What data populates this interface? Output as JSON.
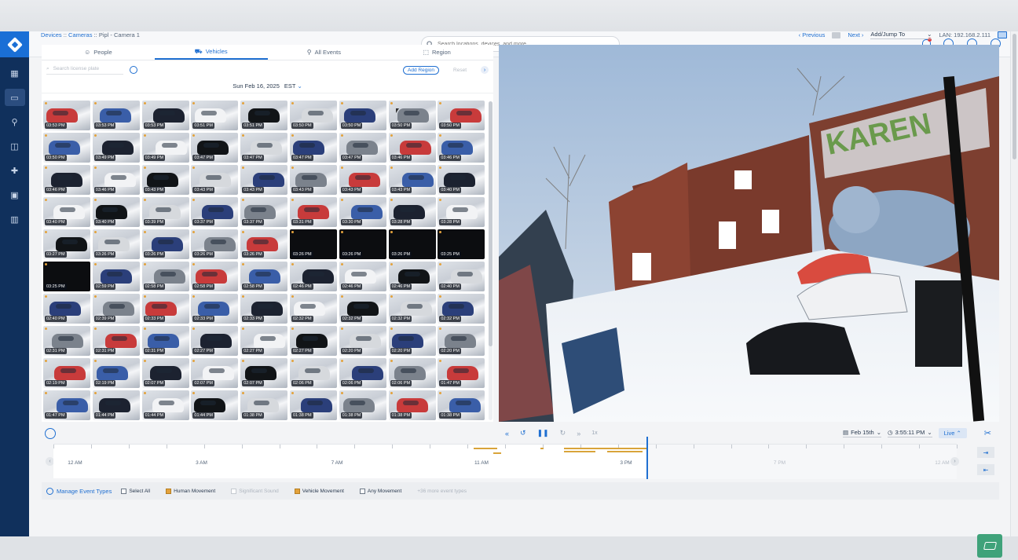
{
  "sidebar": {
    "items": [
      {
        "icon": "dashboard-icon",
        "glyph": "▦"
      },
      {
        "icon": "cameras-icon",
        "glyph": "▭"
      },
      {
        "icon": "location-pin-icon",
        "glyph": "⚲"
      },
      {
        "icon": "map-icon",
        "glyph": "◫"
      },
      {
        "icon": "access-control-icon",
        "glyph": "✚"
      },
      {
        "icon": "video-wall-icon",
        "glyph": "▣"
      },
      {
        "icon": "analytics-icon",
        "glyph": "▥"
      }
    ]
  },
  "search": {
    "placeholder": "Search locations, devices, and more"
  },
  "breadcrumb": {
    "devices": "Devices",
    "sep1": " :: ",
    "cameras": "Cameras",
    "sep2": " :: ",
    "current": "Pipl - Camera 1"
  },
  "nav": {
    "previous": "‹ Previous",
    "next": "Next ›",
    "jump": "Add/Jump To",
    "lan": "LAN: 192.168.2.111"
  },
  "tabs": [
    {
      "label": "People",
      "glyph": "☺"
    },
    {
      "label": "Vehicles",
      "glyph": "⛟"
    },
    {
      "label": "All Events",
      "glyph": "⚲"
    },
    {
      "label": "Region",
      "glyph": "⬚"
    }
  ],
  "filter": {
    "search_placeholder": "Search license plate",
    "add_region": "Add Region",
    "reset": "Reset"
  },
  "date": {
    "day": "Sun Feb 16, 2025",
    "tz": "EST"
  },
  "thumbnails": [
    "03:53 PM",
    "03:53 PM",
    "03:53 PM",
    "03:51 PM",
    "03:51 PM",
    "03:50 PM",
    "03:50 PM",
    "03:50 PM",
    "03:50 PM",
    "03:50 PM",
    "03:49 PM",
    "03:49 PM",
    "03:47 PM",
    "03:47 PM",
    "03:47 PM",
    "03:47 PM",
    "03:46 PM",
    "03:46 PM",
    "03:46 PM",
    "03:46 PM",
    "03:43 PM",
    "03:43 PM",
    "03:43 PM",
    "03:43 PM",
    "03:43 PM",
    "03:43 PM",
    "03:40 PM",
    "03:40 PM",
    "03:40 PM",
    "03:39 PM",
    "03:37 PM",
    "03:37 PM",
    "03:31 PM",
    "03:30 PM",
    "03:28 PM",
    "03:28 PM",
    "03:27 PM",
    "03:26 PM",
    "03:26 PM",
    "03:26 PM",
    "03:26 PM",
    "03:26 PM",
    "03:26 PM",
    "03:26 PM",
    "03:25 PM",
    "03:25 PM",
    "02:59 PM",
    "02:58 PM",
    "02:58 PM",
    "02:58 PM",
    "02:46 PM",
    "02:46 PM",
    "02:46 PM",
    "02:40 PM",
    "02:40 PM",
    "02:39 PM",
    "02:33 PM",
    "02:33 PM",
    "02:33 PM",
    "02:32 PM",
    "02:32 PM",
    "02:32 PM",
    "02:32 PM",
    "02:31 PM",
    "02:31 PM",
    "02:31 PM",
    "02:27 PM",
    "02:27 PM",
    "02:27 PM",
    "02:20 PM",
    "02:20 PM",
    "02:20 PM",
    "02:19 PM",
    "02:19 PM",
    "02:07 PM",
    "02:07 PM",
    "02:07 PM",
    "02:06 PM",
    "02:06 PM",
    "02:06 PM",
    "01:47 PM",
    "01:47 PM",
    "01:44 PM",
    "01:44 PM",
    "01:44 PM",
    "01:38 PM",
    "01:38 PM",
    "01:38 PM",
    "01:38 PM",
    "01:38 PM"
  ],
  "dark_thumbs": [
    41,
    42,
    43,
    44,
    45
  ],
  "car_colors": [
    "#f2f3f5",
    "#1c2230",
    "#3a5ea8",
    "#c83b3b",
    "#7b828c",
    "#2b3f7a",
    "#d6d9dd",
    "#111417"
  ],
  "playback": {
    "rewind": "«",
    "back": "↺",
    "pause": "❚❚",
    "forward": "↻",
    "fastforward": "»",
    "rate": "1x"
  },
  "timeline_ctl": {
    "date": "Feb 15th",
    "time": "3:55:11 PM",
    "live": "Live"
  },
  "timeline": {
    "labels": [
      "12 AM",
      "3 AM",
      "7 AM",
      "11 AM",
      "3 PM",
      "7 PM",
      "12 AM"
    ],
    "future_from": 5
  },
  "events": {
    "manage": "Manage Event Types",
    "options": [
      {
        "label": "Select All",
        "state": "unchecked"
      },
      {
        "label": "Human Movement",
        "state": "checked"
      },
      {
        "label": "Significant Sound",
        "state": "disabled"
      },
      {
        "label": "Vehicle Movement",
        "state": "checked"
      },
      {
        "label": "Any Movement",
        "state": "unchecked"
      }
    ],
    "more": "+36 more event types"
  },
  "camera_view": {
    "mural_text": "KAREN"
  },
  "colors": {
    "accent": "#1f6fd1",
    "rail": "#10305c",
    "event": "#d9a43a"
  }
}
